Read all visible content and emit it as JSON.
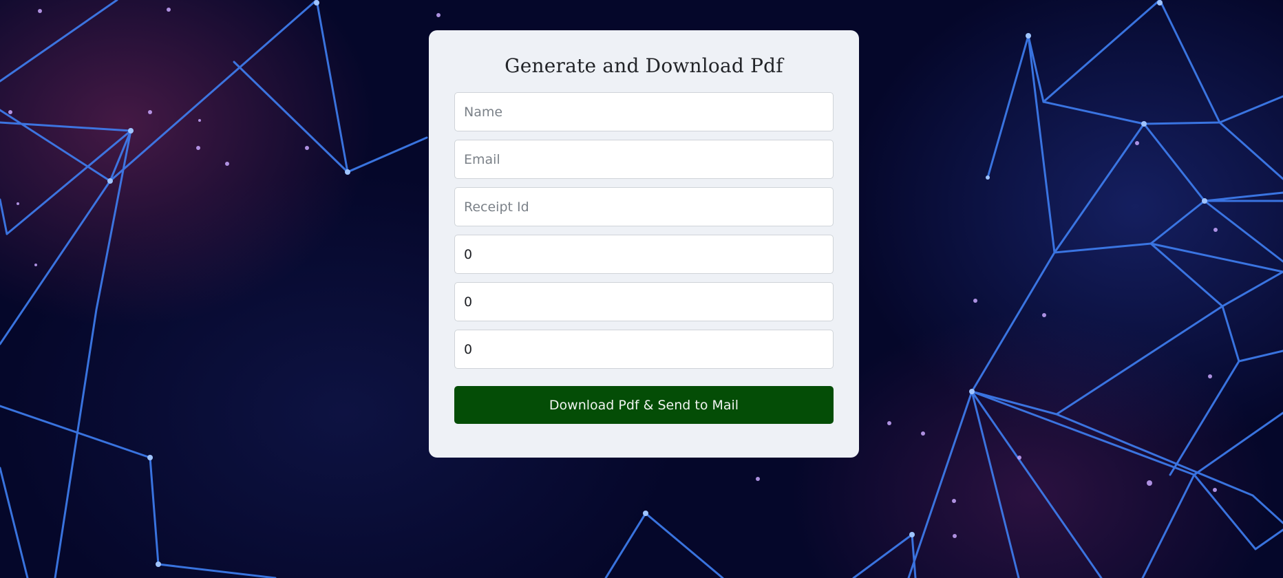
{
  "form": {
    "title": "Generate and Download Pdf",
    "fields": [
      {
        "name": "name-input",
        "placeholder": "Name",
        "value": ""
      },
      {
        "name": "email-input",
        "placeholder": "Email",
        "value": ""
      },
      {
        "name": "receipt-id-input",
        "placeholder": "Receipt Id",
        "value": ""
      },
      {
        "name": "number-input-1",
        "placeholder": "",
        "value": "0"
      },
      {
        "name": "number-input-2",
        "placeholder": "",
        "value": "0"
      },
      {
        "name": "number-input-3",
        "placeholder": "",
        "value": "0"
      }
    ],
    "submit_label": "Download Pdf & Send to Mail"
  },
  "colors": {
    "background": "#05072a",
    "card": "#eef1f6",
    "button": "#044d06",
    "network_lines": "#3d7bf0"
  }
}
